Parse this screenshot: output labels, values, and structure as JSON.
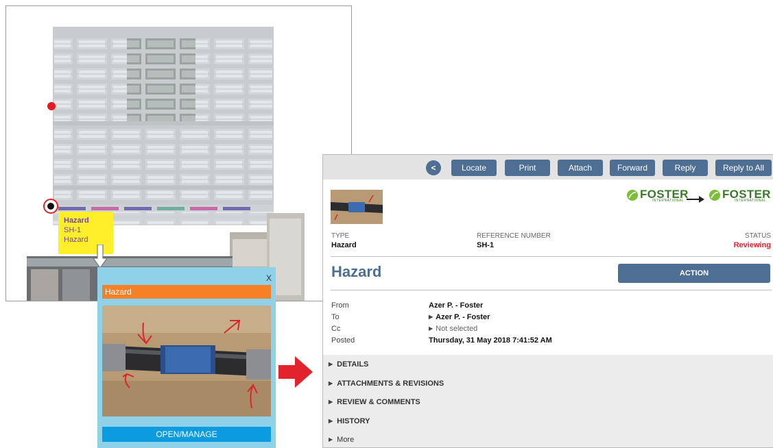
{
  "map": {
    "tooltip": {
      "line1": "Hazard",
      "line2": "SH-1",
      "line3": "Hazard"
    }
  },
  "popup": {
    "close": "X",
    "header": "Hazard",
    "open_button": "OPEN/MANAGE"
  },
  "toolbar": {
    "back": "<",
    "buttons": [
      "Locate",
      "Print",
      "Attach",
      "Forward",
      "Reply",
      "Reply to All"
    ]
  },
  "logos": {
    "from": {
      "name": "FOSTER",
      "sub": "INTERNATIONAL"
    },
    "to": {
      "name": "FOSTER",
      "sub": "INTERNATIONAL"
    }
  },
  "summary": {
    "type_label": "TYPE",
    "type_value": "Hazard",
    "ref_label": "REFERENCE NUMBER",
    "ref_value": "SH-1",
    "status_label": "STATUS",
    "status_value": "Reviewing"
  },
  "title": "Hazard",
  "action_button": "ACTION",
  "fields": {
    "from_label": "From",
    "from_value": "Azer P. - Foster",
    "to_label": "To",
    "to_value": "Azer P. - Foster",
    "cc_label": "Cc",
    "cc_value": "Not selected",
    "posted_label": "Posted",
    "posted_value": "Thursday, 31 May 2018 7:41:52 AM"
  },
  "sections": [
    "DETAILS",
    "ATTACHMENTS & REVISIONS",
    "REVIEW & COMMENTS",
    "HISTORY",
    "More"
  ],
  "colors": {
    "button": "#4f6e93",
    "status": "#e3232b",
    "popup_bg": "#8fd1e8",
    "popup_header": "#f58025",
    "popup_button": "#0b9be0",
    "tooltip_bg": "#ffef2a",
    "arrow": "#e3232b"
  }
}
